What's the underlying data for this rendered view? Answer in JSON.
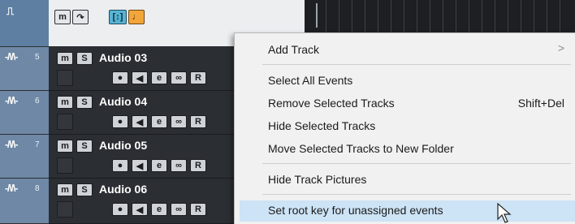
{
  "header": {
    "folder_icon": "⎍",
    "buttons": [
      {
        "label": "m",
        "name": "mute-all-button"
      },
      {
        "label": "↷",
        "name": "monitor-toggle-button"
      },
      {
        "label": "[↕]",
        "name": "expand-button"
      },
      {
        "label": "♩",
        "name": "note-button"
      }
    ]
  },
  "tracks": [
    {
      "number": "5",
      "name": "Audio 03"
    },
    {
      "number": "6",
      "name": "Audio 04"
    },
    {
      "number": "7",
      "name": "Audio 05"
    },
    {
      "number": "8",
      "name": "Audio 06"
    }
  ],
  "track_buttons": {
    "mute": "m",
    "solo": "S",
    "record": "●",
    "monitor": "◀",
    "edit": "e",
    "link": "∞",
    "read": "R"
  },
  "menu": {
    "items": [
      {
        "label": "Add Track",
        "shortcut": "",
        "submenu": true
      },
      {
        "label": "Select All Events",
        "shortcut": ""
      },
      {
        "label": "Remove Selected Tracks",
        "shortcut": "Shift+Del"
      },
      {
        "label": "Hide Selected Tracks",
        "shortcut": ""
      },
      {
        "label": "Move Selected Tracks to New Folder",
        "shortcut": ""
      },
      {
        "label": "Hide Track Pictures",
        "shortcut": ""
      },
      {
        "label": "Set root key for unassigned events",
        "shortcut": "",
        "highlighted": true
      }
    ],
    "submenu_glyph": ">"
  },
  "colors": {
    "track_header": "#6e88a6",
    "menu_highlight": "#cde3f6",
    "expand_button": "#57b4d3",
    "note_button": "#f2a63a"
  }
}
